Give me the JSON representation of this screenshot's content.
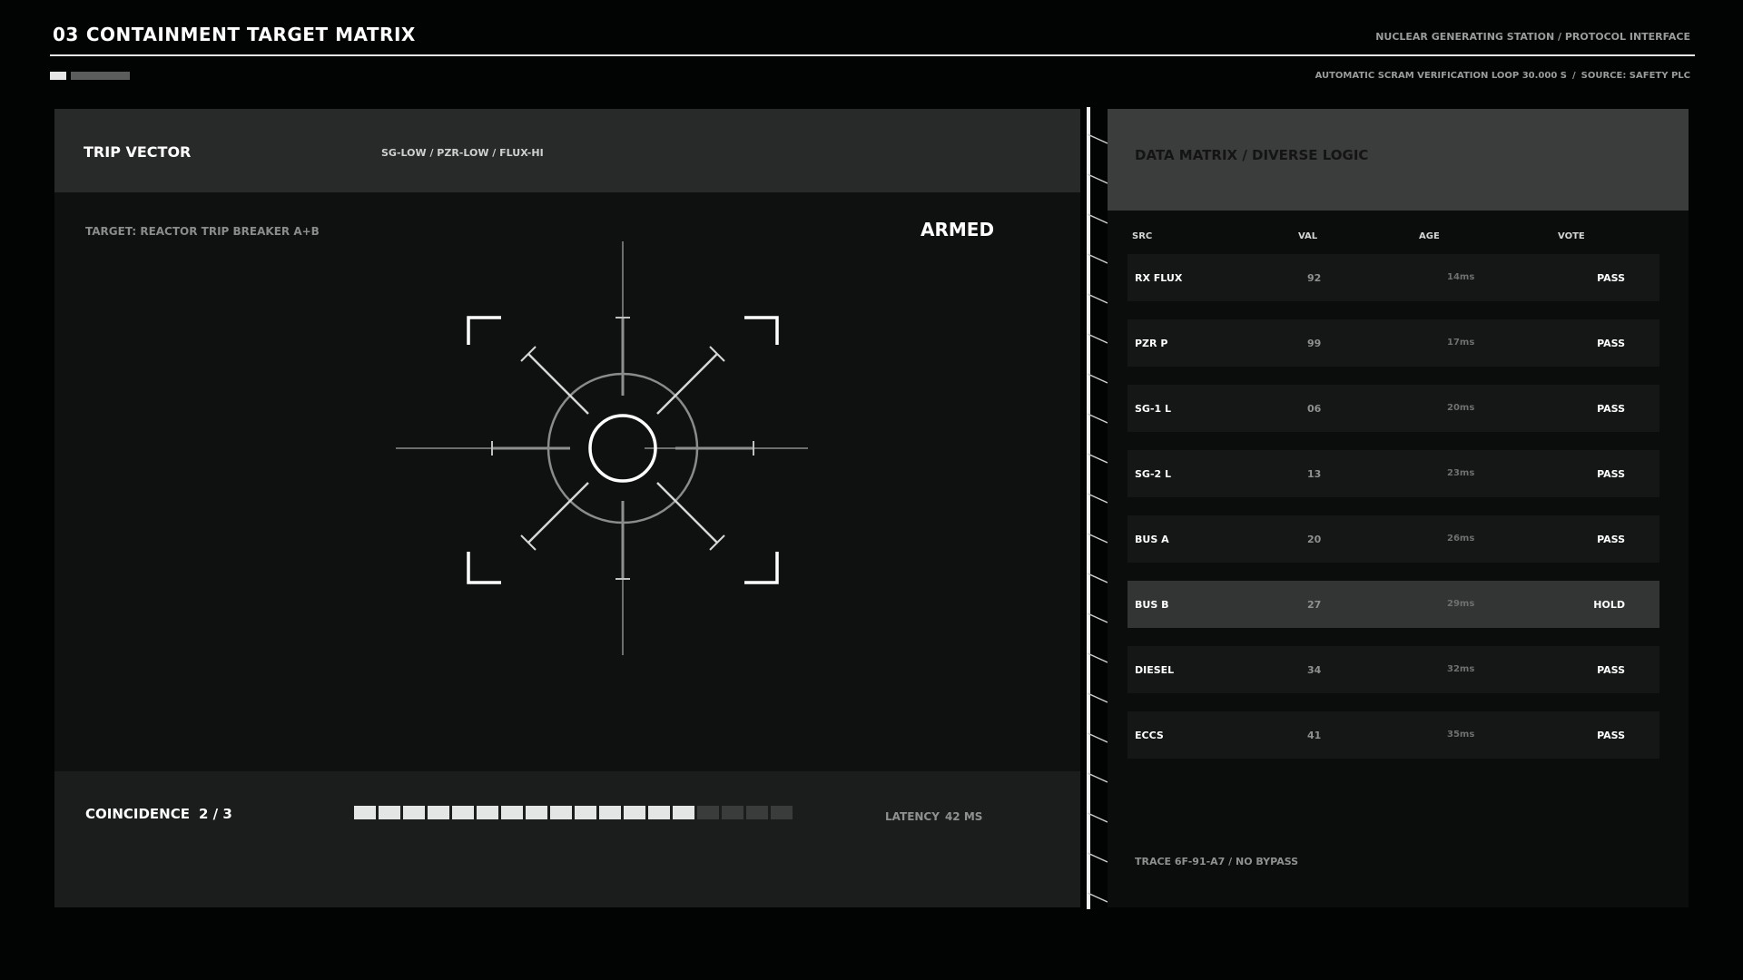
{
  "header": {
    "number": "03",
    "title": "CONTAINMENT TARGET MATRIX",
    "system": "NUCLEAR GENERATING STATION / PROTOCOL INTERFACE",
    "meta_left": "AUTOMATIC SCRAM VERIFICATION  LOOP 30.000 S",
    "meta_sep": "/",
    "meta_right": "SOURCE: SAFETY PLC"
  },
  "trip": {
    "label": "TRIP VECTOR",
    "codes": "SG-LOW / PZR-LOW / FLUX-HI",
    "target": "TARGET: REACTOR TRIP BREAKER A+B",
    "status": "ARMED"
  },
  "coincidence": {
    "label": "COINCIDENCE",
    "value": "2 / 3",
    "segments_total": 18,
    "segments_lit": 14,
    "latency_label": "LATENCY",
    "latency_value": "42 MS"
  },
  "matrix": {
    "title": "DATA MATRIX / DIVERSE LOGIC",
    "columns": [
      "SRC",
      "VAL",
      "AGE",
      "VOTE"
    ],
    "rows": [
      {
        "src": "RX FLUX",
        "val": "92",
        "age": "14ms",
        "vote": "PASS"
      },
      {
        "src": "PZR P",
        "val": "99",
        "age": "17ms",
        "vote": "PASS"
      },
      {
        "src": "SG-1 L",
        "val": "06",
        "age": "20ms",
        "vote": "PASS"
      },
      {
        "src": "SG-2 L",
        "val": "13",
        "age": "23ms",
        "vote": "PASS"
      },
      {
        "src": "BUS A",
        "val": "20",
        "age": "26ms",
        "vote": "PASS"
      },
      {
        "src": "BUS B",
        "val": "27",
        "age": "29ms",
        "vote": "HOLD"
      },
      {
        "src": "DIESEL",
        "val": "34",
        "age": "32ms",
        "vote": "PASS"
      },
      {
        "src": "ECCS",
        "val": "41",
        "age": "35ms",
        "vote": "PASS"
      }
    ],
    "trace": "TRACE  6F-91-A7 / NO BYPASS"
  }
}
